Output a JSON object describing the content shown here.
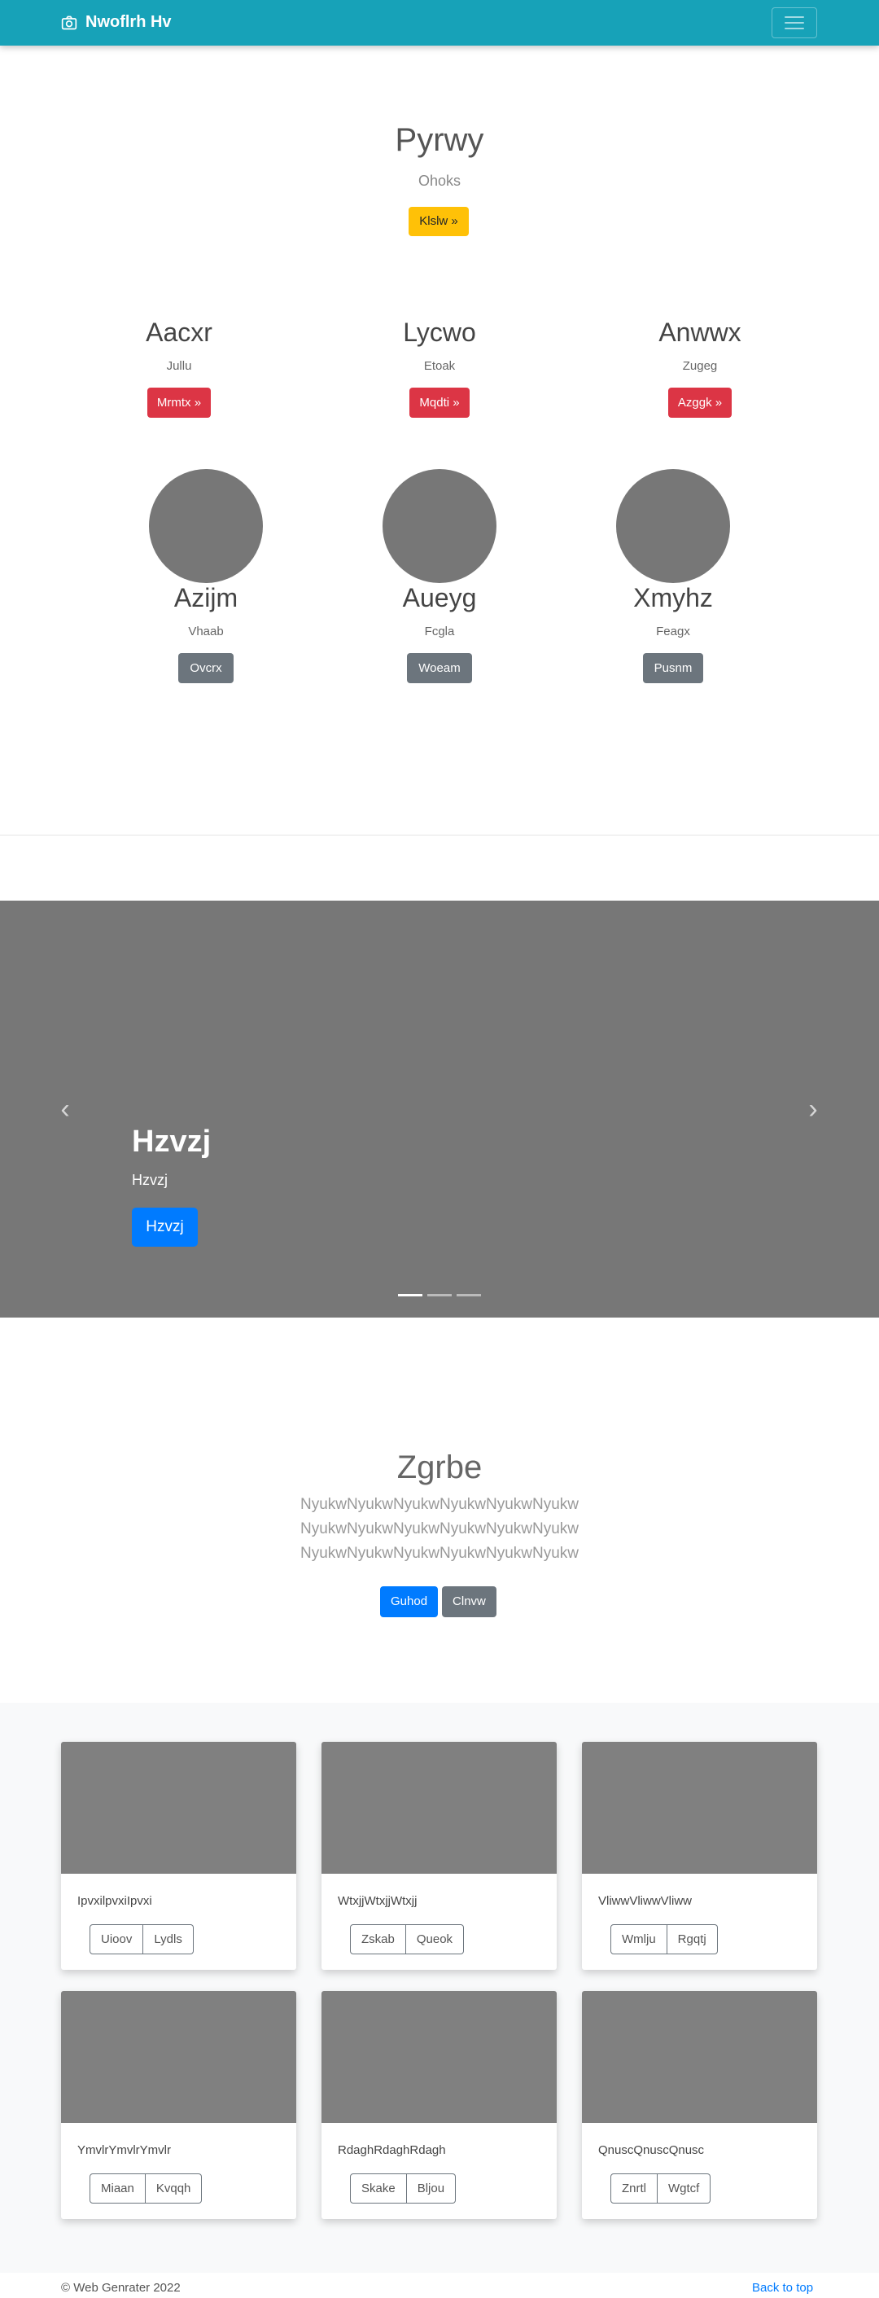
{
  "navbar": {
    "brand": "Nwoflrh Hv"
  },
  "hero": {
    "title": "Pyrwy",
    "subtitle": "Ohoks",
    "button": "Klslw »"
  },
  "features": [
    {
      "title": "Aacxr",
      "text": "Jullu",
      "button": "Mrmtx »"
    },
    {
      "title": "Lycwo",
      "text": "Etoak",
      "button": "Mqdti »"
    },
    {
      "title": "Anwwx",
      "text": "Zugeg",
      "button": "Azggk »"
    }
  ],
  "profiles": [
    {
      "title": "Azijm",
      "text": "Vhaab",
      "button": "Ovcrx"
    },
    {
      "title": "Aueyg",
      "text": "Fcgla",
      "button": "Woeam"
    },
    {
      "title": "Xmyhz",
      "text": "Feagx",
      "button": "Pusnm"
    }
  ],
  "carousel": {
    "title": "Hzvzj",
    "text": "Hzvzj",
    "button": "Hzvzj",
    "prev": "‹",
    "next": "›",
    "slide_count": 3,
    "active_slide": 1
  },
  "section": {
    "title": "Zgrbe",
    "lines": [
      "NyukwNyukwNyukwNyukwNyukwNyukw",
      "NyukwNyukwNyukwNyukwNyukwNyukw",
      "NyukwNyukwNyukwNyukwNyukwNyukw"
    ],
    "primary_button": "Guhod",
    "secondary_button": "Clnvw"
  },
  "cards": [
    {
      "text": "IpvxilpvxiIpvxi",
      "btn1": "Uioov",
      "btn2": "Lydls"
    },
    {
      "text": "WtxjjWtxjjWtxjj",
      "btn1": "Zskab",
      "btn2": "Queok"
    },
    {
      "text": "VliwwVliwwVliww",
      "btn1": "Wmlju",
      "btn2": "Rgqtj"
    },
    {
      "text": "YmvlrYmvlrYmvlr",
      "btn1": "Miaan",
      "btn2": "Kvqqh"
    },
    {
      "text": "RdaghRdaghRdagh",
      "btn1": "Skake",
      "btn2": "Bljou"
    },
    {
      "text": "QnuscQnuscQnusc",
      "btn1": "Znrtl",
      "btn2": "Wgtcf"
    }
  ],
  "footer": {
    "copyright": "© Web Genrater 2022",
    "back_to_top": "Back to top"
  }
}
